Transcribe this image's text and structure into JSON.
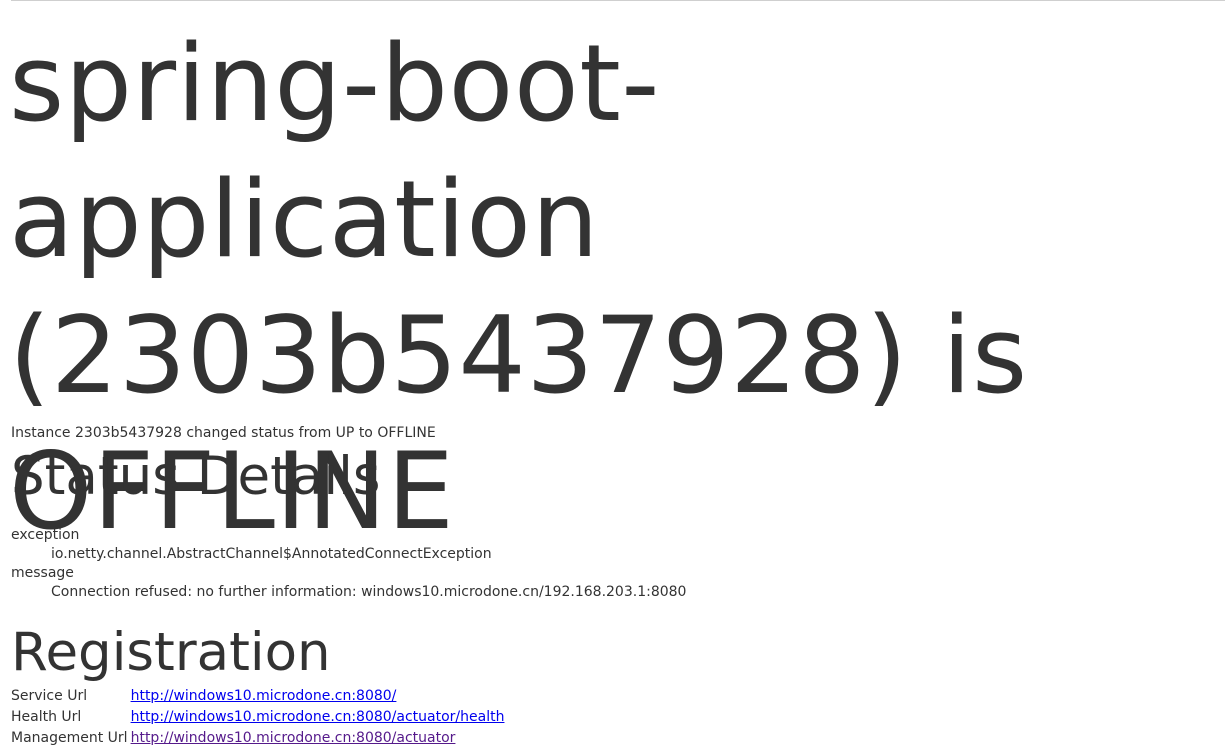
{
  "page": {
    "title": "spring-boot-application (2303b5437928) is OFFLINE",
    "summary": "Instance 2303b5437928 changed status from UP to OFFLINE"
  },
  "status_details": {
    "heading": "Status Details",
    "items": [
      {
        "term": "exception",
        "value": "io.netty.channel.AbstractChannel$AnnotatedConnectException"
      },
      {
        "term": "message",
        "value": "Connection refused: no further information: windows10.microdone.cn/192.168.203.1:8080"
      }
    ]
  },
  "registration": {
    "heading": "Registration",
    "rows": [
      {
        "label": "Service Url",
        "url": "http://windows10.microdone.cn:8080/"
      },
      {
        "label": "Health Url",
        "url": "http://windows10.microdone.cn:8080/actuator/health"
      },
      {
        "label": "Management Url",
        "url": "http://windows10.microdone.cn:8080/actuator"
      }
    ]
  },
  "colors": {
    "text": "#333333",
    "link": "#0000ee",
    "visited_link": "#551a8b"
  }
}
